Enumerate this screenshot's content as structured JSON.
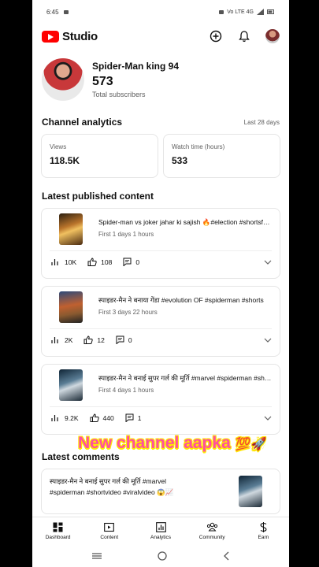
{
  "status_bar": {
    "time": "6:45",
    "right_text": "Vo LTE 4G"
  },
  "app_bar": {
    "title": "Studio"
  },
  "channel": {
    "name": "Spider-Man king 94",
    "subscribers": "573",
    "subscribers_label": "Total subscribers"
  },
  "analytics": {
    "title": "Channel analytics",
    "period": "Last 28 days",
    "cards": [
      {
        "label": "Views",
        "value": "118.5K"
      },
      {
        "label": "Watch time (hours)",
        "value": "533"
      }
    ]
  },
  "latest_content": {
    "title": "Latest published content",
    "items": [
      {
        "title": "Spider-man vs joker jahar ki sajish 🔥#election #shortsfeed",
        "subtitle": "First 1 days 1 hours",
        "views": "10K",
        "likes": "108",
        "comments": "0"
      },
      {
        "title": "स्पाइडर-मैन ने बनाया गेंडा #evolution  OF #spiderman #shorts",
        "subtitle": "First 3 days 22 hours",
        "views": "2K",
        "likes": "12",
        "comments": "0"
      },
      {
        "title": "स्पाइडर-मैन ने बनाई सुपर गर्ल की मूर्ति  #marvel #spiderman #shorts",
        "subtitle": "First 4 days 1 hours",
        "views": "9.2K",
        "likes": "440",
        "comments": "1"
      }
    ]
  },
  "overlay": {
    "text": "New channel aapka",
    "emoji": "💯🚀"
  },
  "latest_comments": {
    "title": "Latest comments",
    "comment_line1": "स्पाइडर-मैन ने बनाई सुपर गर्ल की मूर्ति  #marvel",
    "comment_line2": "#spiderman #shortvideo #viralvideo 😱📈"
  },
  "bottom_nav": [
    {
      "label": "Dashboard",
      "icon": "dashboard-icon"
    },
    {
      "label": "Content",
      "icon": "content-icon"
    },
    {
      "label": "Analytics",
      "icon": "analytics-icon"
    },
    {
      "label": "Community",
      "icon": "community-icon"
    },
    {
      "label": "Earn",
      "icon": "earn-icon"
    }
  ],
  "colors": {
    "brand_red": "#ff0000",
    "overlay_text": "#ff4fa0",
    "overlay_outline": "#ffe600"
  }
}
